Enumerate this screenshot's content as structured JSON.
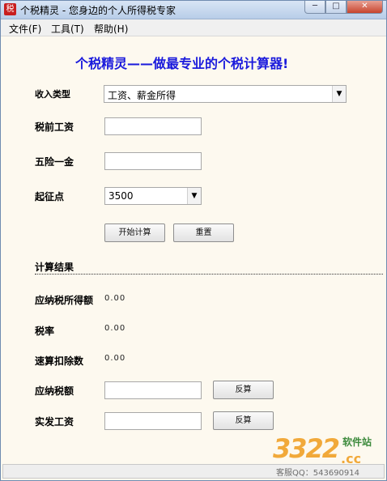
{
  "window": {
    "app_icon_text": "税",
    "title": "个税精灵 - 您身边的个人所得税专家",
    "min": "─",
    "max": "□",
    "close": "✕"
  },
  "menu": [
    "文件(F)",
    "工具(T)",
    "帮助(H)"
  ],
  "heading": "个税精灵——做最专业的个税计算器!",
  "form": {
    "income_type_label": "收入类型",
    "income_type_value": "工资、薪金所得",
    "pretax_label": "税前工资",
    "pretax_value": "",
    "insurance_label": "五险一金",
    "insurance_value": "",
    "threshold_label": "起征点",
    "threshold_value": "3500",
    "calc_button": "开始计算",
    "reset_button": "重置"
  },
  "results": {
    "section_title": "计算结果",
    "taxable_income_label": "应纳税所得额",
    "taxable_income_value": "0.00",
    "rate_label": "税率",
    "rate_value": "0.00",
    "deduction_label": "速算扣除数",
    "deduction_value": "0.00",
    "tax_due_label": "应纳税额",
    "tax_due_value": "",
    "net_salary_label": "实发工资",
    "net_salary_value": "",
    "reverse_button": "反算"
  },
  "watermark": {
    "number": "3322",
    "cc": ".cc",
    "site": "软件站",
    "qq": "客服QQ：543690914"
  },
  "colors": {
    "heading": "#1a1adc",
    "window_bg": "#fdf9ef",
    "watermark": "#f1a93a"
  }
}
